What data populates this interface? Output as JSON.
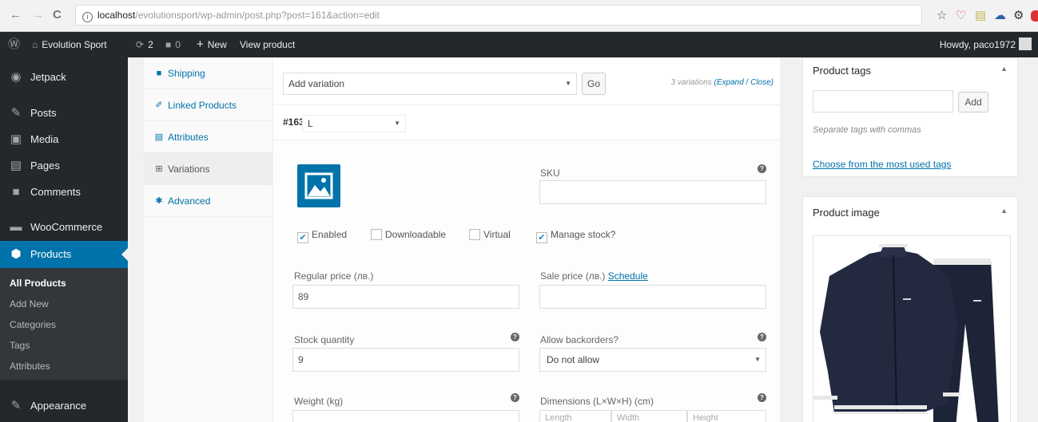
{
  "browser": {
    "back": "←",
    "forward": "→",
    "reload": "C",
    "info": "i",
    "url_host": "localhost",
    "url_path": "/evolutionsport/wp-admin/post.php?post=161&action=edit",
    "star": "☆",
    "ext_icons": [
      "♡",
      "▤",
      "☁",
      "⚙"
    ]
  },
  "admin_bar": {
    "site_name": "Evolution Sport",
    "updates": "2",
    "comments": "0",
    "new": "New",
    "view": "View product",
    "howdy": "Howdy, paco1972"
  },
  "sidebar": {
    "items": [
      {
        "label": "Jetpack",
        "icon": "jetpack-icon"
      },
      {
        "label": "Posts",
        "icon": "pin-icon"
      },
      {
        "label": "Media",
        "icon": "media-icon"
      },
      {
        "label": "Pages",
        "icon": "page-icon"
      },
      {
        "label": "Comments",
        "icon": "comment-icon"
      },
      {
        "label": "WooCommerce",
        "icon": "woo-icon"
      },
      {
        "label": "Products",
        "icon": "product-icon"
      },
      {
        "label": "Appearance",
        "icon": "brush-icon"
      }
    ],
    "submenu": [
      "All Products",
      "Add New",
      "Categories",
      "Tags",
      "Attributes"
    ]
  },
  "tabs": [
    {
      "label": "Shipping",
      "icon": "truck-icon"
    },
    {
      "label": "Linked Products",
      "icon": "link-icon"
    },
    {
      "label": "Attributes",
      "icon": "list-icon"
    },
    {
      "label": "Variations",
      "icon": "grid-icon"
    },
    {
      "label": "Advanced",
      "icon": "gear-icon"
    }
  ],
  "variations": {
    "add_select": "Add variation",
    "go": "Go",
    "count": "3 variations",
    "expand_close": "(Expand / Close)",
    "id": "#163",
    "size_value": "L",
    "sku_label": "SKU",
    "enabled": "Enabled",
    "downloadable": "Downloadable",
    "virtual": "Virtual",
    "manage_stock": "Manage stock?",
    "regular_price_label": "Regular price (лв.)",
    "regular_price_value": "89",
    "sale_price_label": "Sale price (лв.)",
    "schedule": "Schedule",
    "stock_qty_label": "Stock quantity",
    "stock_qty_value": "9",
    "backorders_label": "Allow backorders?",
    "backorders_value": "Do not allow",
    "weight_label": "Weight (kg)",
    "dimensions_label": "Dimensions (L×W×H) (cm)",
    "length_ph": "Length",
    "width_ph": "Width",
    "height_ph": "Height"
  },
  "right": {
    "tags_title": "Product tags",
    "add_btn": "Add",
    "tags_hint": "Separate tags with commas",
    "tags_link": "Choose from the most used tags",
    "image_title": "Product image"
  },
  "colors": {
    "admin_dark": "#23282d",
    "accent": "#0073aa",
    "tracksuit": "#1e2437"
  }
}
